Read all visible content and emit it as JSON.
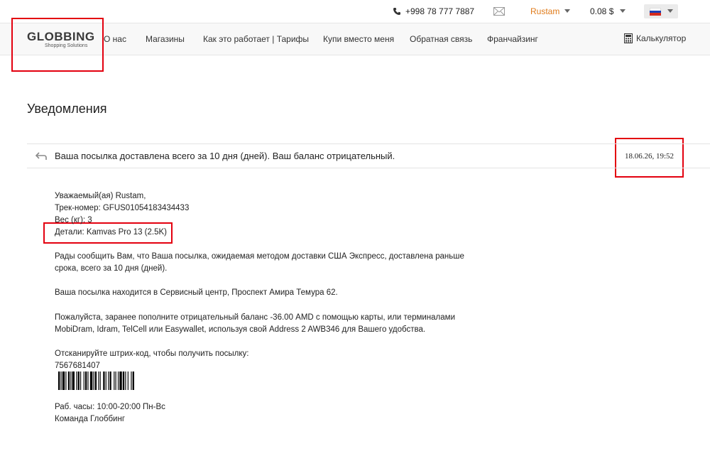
{
  "topbar": {
    "phone": "+998 78 777 7887",
    "user": "Rustam",
    "balance": "0.08 $"
  },
  "logo": {
    "brand": "GLOBBING",
    "tagline": "Shopping Solutions"
  },
  "nav": {
    "items": [
      "О нас",
      "Магазины",
      "Как это работает | Тарифы",
      "Купи вместо меня",
      "Обратная связь",
      "Франчайзинг"
    ],
    "calculator": "Калькулятор"
  },
  "page": {
    "title": "Уведомления"
  },
  "notification": {
    "subject": "Ваша посылка доставлена всего за 10 дня (дней). Ваш баланс отрицательный.",
    "date": "18.06.26, 19:52",
    "greeting": "Уважаемый(ая) Rustam,",
    "tracking": "Трек-номер: GFUS01054183434433",
    "weight": "Вес (кг): 3",
    "details": "Детали: Kamvas Pro 13 (2.5K)",
    "para1_line1": "Рады сообщить Вам, что Ваша посылка, ожидаемая методом доставки США Экспресс, доставлена раньше",
    "para1_line2": "срока, всего за 10 дня (дней).",
    "para2": "Ваша посылка находится в Сервисный центр, Проспект Амира Темура 62.",
    "para3_line1": "Пожалуйста, заранее пополните отрицательный баланс -36.00 AMD с помощью карты, или терминалами",
    "para3_line2": "MobiDram, Idram, TelCell или Easywallet, используя свой Address 2 AWB346 для Вашего удобства.",
    "scan_label": "Отсканируйте штрих-код, чтобы получить посылку:",
    "barcode_number": "7567681407",
    "hours": "Раб. часы: 10:00-20:00 Пн-Вс",
    "signature": "Команда Глоббинг"
  },
  "colors": {
    "accent": "#e07b1a",
    "highlight_box": "#e3000f"
  }
}
